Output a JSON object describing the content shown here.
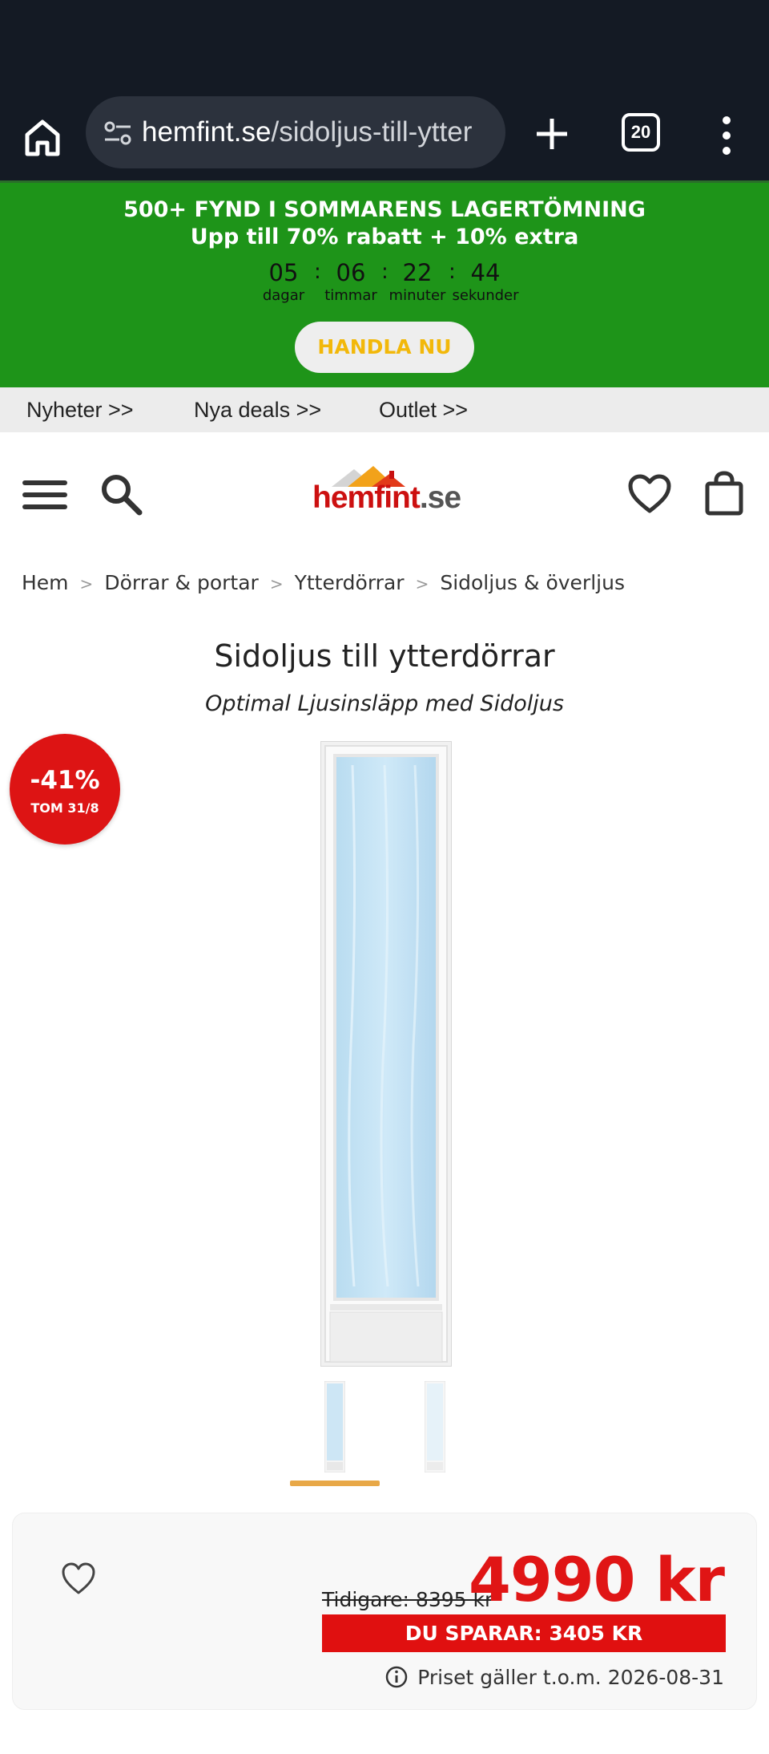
{
  "browser": {
    "url_host": "hemfint.se",
    "url_path": "/sidoljus-till-ytter",
    "tab_count": "20"
  },
  "promo": {
    "title": "500+ FYND I SOMMARENS LAGERTÖMNING",
    "subtitle": "Upp till 70% rabatt + 10% extra",
    "countdown": [
      {
        "value": "05",
        "label": "dagar"
      },
      {
        "value": "06",
        "label": "timmar"
      },
      {
        "value": "22",
        "label": "minuter"
      },
      {
        "value": "44",
        "label": "sekunder"
      }
    ],
    "separator": ":",
    "button_label": "HANDLA NU",
    "button_color": "#f2b80a",
    "background_color": "#1e9419"
  },
  "quicknav": {
    "items": [
      {
        "label": "Nyheter >>"
      },
      {
        "label": "Nya deals >>"
      },
      {
        "label": "Outlet >>"
      }
    ]
  },
  "header": {
    "logo": {
      "part1": "hem",
      "part2": "fint",
      "part3": ".se"
    },
    "icons": [
      "menu-icon",
      "search-icon",
      "heart-icon",
      "bag-icon"
    ]
  },
  "breadcrumb": {
    "items": [
      {
        "label": "Hem"
      },
      {
        "label": "Dörrar & portar"
      },
      {
        "label": "Ytterdörrar"
      },
      {
        "label": "Sidoljus & överljus"
      }
    ],
    "separator": ">"
  },
  "product": {
    "title": "Sidoljus till ytterdörrar",
    "subtitle": "Optimal Ljusinsläpp med Sidoljus",
    "badge": {
      "discount": "-41%",
      "until": "TOM 31/8",
      "color": "#dd1414"
    },
    "thumbnails_count": 2,
    "active_thumbnail": 1
  },
  "pricing": {
    "previous_price": "Tidigare: 8395 kr",
    "price": "4990 kr",
    "savings": "DU SPARAR: 3405 KR",
    "valid_until": "Priset gäller t.o.m. 2026-08-31",
    "price_color": "#e01515"
  }
}
